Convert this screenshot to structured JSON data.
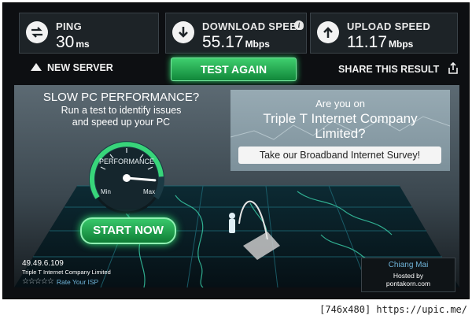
{
  "stats": {
    "ping": {
      "label": "PING",
      "value": "30",
      "unit": "ms"
    },
    "download": {
      "label": "DOWNLOAD SPEED",
      "value": "55.17",
      "unit": "Mbps",
      "info": "i"
    },
    "upload": {
      "label": "UPLOAD SPEED",
      "value": "11.17",
      "unit": "Mbps"
    }
  },
  "actions": {
    "new_server": "NEW SERVER",
    "test_again": "TEST AGAIN",
    "share": "SHARE THIS RESULT"
  },
  "promo": {
    "title": "SLOW PC PERFORMANCE?",
    "line1": "Run a test to identify issues",
    "line2": "and speed up your PC",
    "gauge_label": "PERFORMANCE",
    "gauge_min": "Min",
    "gauge_max": "Max",
    "gauge_level": 0.85,
    "start": "START NOW"
  },
  "ad": {
    "small": "Are you on",
    "big": "Triple T Internet Company Limited?",
    "survey": "Take our Broadband Internet Survey!"
  },
  "isp": {
    "ip": "49.49.6.109",
    "name": "Triple T Internet Company Limited",
    "rate_label": "Rate Your ISP",
    "stars": 0
  },
  "server": {
    "city": "Chiang Mai",
    "hosted_by": "Hosted by",
    "host": "pontakorn.com"
  },
  "colors": {
    "accent_green": "#2fd36a",
    "frame_bg": "#0d0f12"
  },
  "watermark": "[746x480] https://upic.me/"
}
